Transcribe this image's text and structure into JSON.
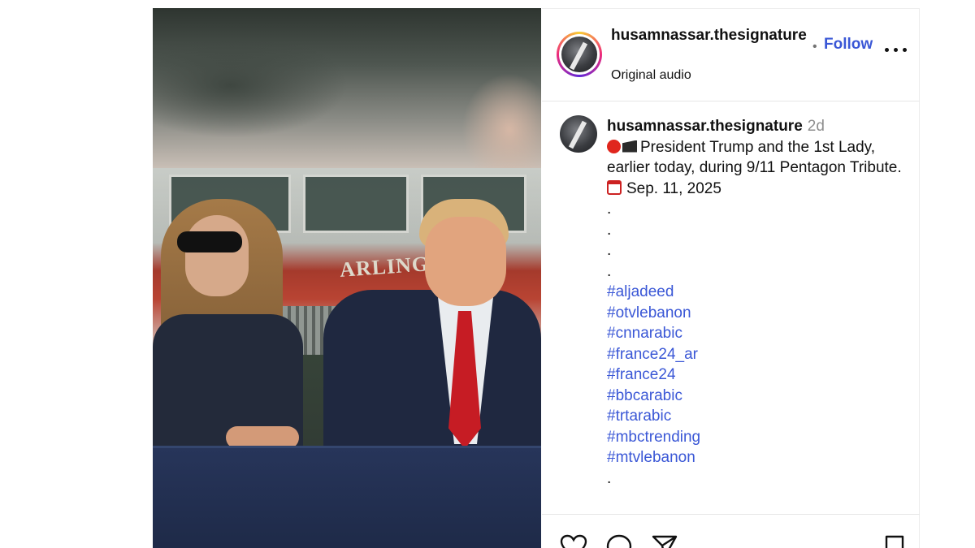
{
  "post": {
    "username": "husamnassar.thesignature",
    "audio": "Original audio",
    "follow_label": "Follow",
    "separator": "•"
  },
  "caption": {
    "username": "husamnassar.thesignature",
    "time": "2d",
    "text_line1": "President Trump and the 1st Lady, earlier today, during 9/11 Pentagon Tribute.",
    "date_line": "Sep. 11, 2025",
    "dots": [
      ".",
      ".",
      ".",
      "."
    ],
    "hashtags": [
      "#aljadeed",
      "#otvlebanon",
      "#cnnarabic",
      "#france24_ar",
      "#france24",
      "#bbcarabic",
      "#trtarabic",
      "#mbctrending",
      "#mtvlebanon"
    ],
    "trailing_dot": "."
  },
  "media": {
    "truck_text": "ARLINGTON"
  },
  "icons": {
    "like": "heart-icon",
    "comment": "comment-icon",
    "share": "share-icon",
    "save": "bookmark-icon",
    "more": "more-options-icon",
    "record": "red-circle-icon",
    "clapper": "clapper-board-icon",
    "calendar": "calendar-icon"
  },
  "colors": {
    "link": "#3a57d6",
    "muted": "#8e8e8e"
  }
}
